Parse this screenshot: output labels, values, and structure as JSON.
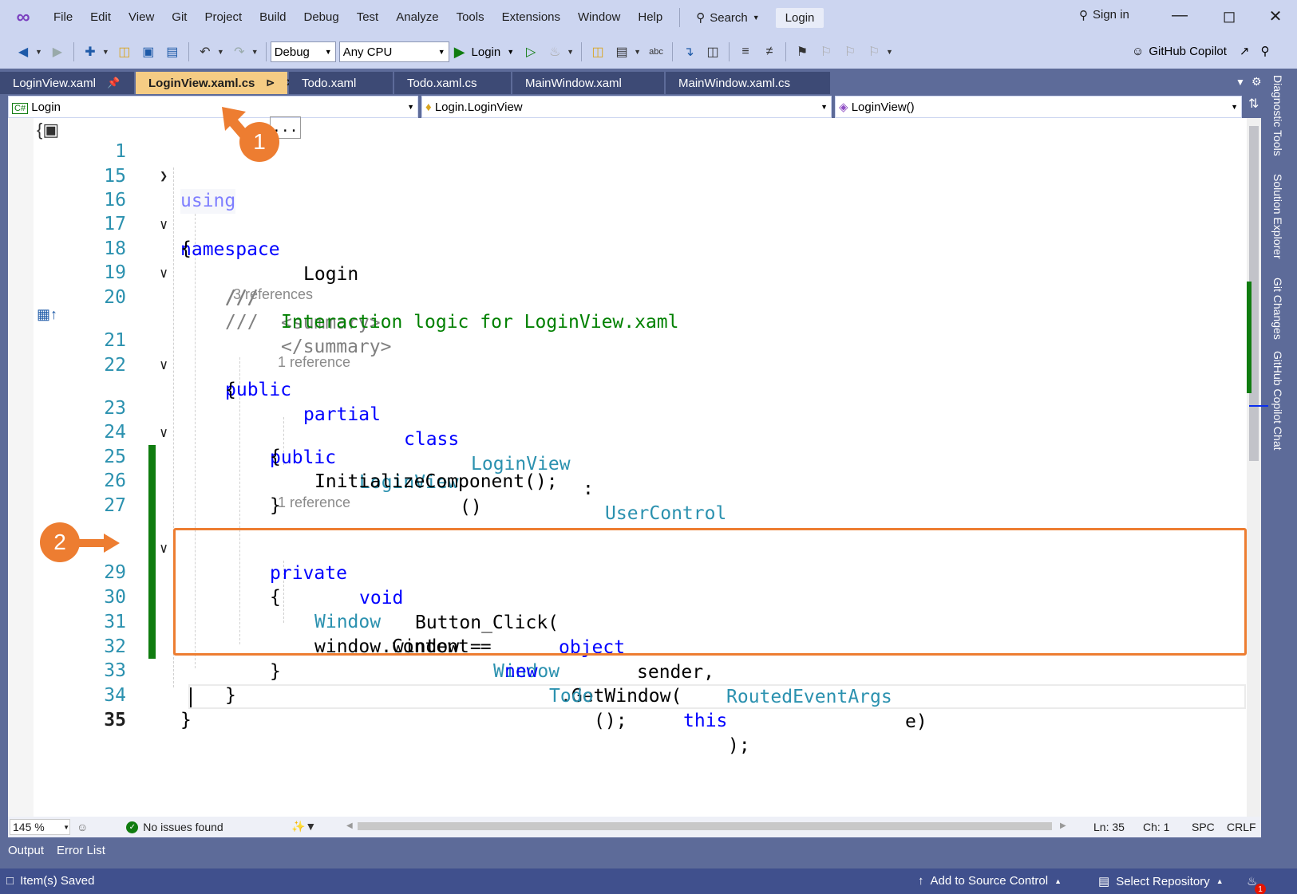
{
  "menu": {
    "items": [
      "File",
      "Edit",
      "View",
      "Git",
      "Project",
      "Build",
      "Debug",
      "Test",
      "Analyze",
      "Tools",
      "Extensions",
      "Window",
      "Help"
    ],
    "search_label": "Search",
    "solution_name": "Login",
    "sign_in": "Sign in"
  },
  "toolbar": {
    "configuration": "Debug",
    "platform": "Any CPU",
    "run_target": "Login",
    "copilot_label": "GitHub Copilot"
  },
  "tabs": [
    {
      "label": "LoginView.xaml"
    },
    {
      "label": "LoginView.xaml.cs"
    },
    {
      "label": "Todo.xaml"
    },
    {
      "label": "Todo.xaml.cs"
    },
    {
      "label": "MainWindow.xaml"
    },
    {
      "label": "MainWindow.xaml.cs"
    }
  ],
  "navbar": {
    "project": "Login",
    "type": "Login.LoginView",
    "member": "LoginView()"
  },
  "code": {
    "line_numbers": [
      "1",
      "15",
      "16",
      "17",
      "18",
      "19",
      "20",
      "21",
      "22",
      "23",
      "24",
      "25",
      "26",
      "27",
      "29",
      "30",
      "31",
      "32",
      "33",
      "34",
      "35"
    ],
    "l1_using": "using",
    "l1_collapsed": "...",
    "l16_kw": "namespace",
    "l16_name": "Login",
    "brace_open": "{",
    "brace_close": "}",
    "l18_prefix": "/// ",
    "l18_tag": "<summary>",
    "l19_prefix": "/// ",
    "l19_text": "Interaction logic for LoginView.xaml",
    "l20_prefix": "/// ",
    "l20_tag": "</summary>",
    "lens_class": "3 references",
    "l21_kw1": "public",
    "l21_kw2": "partial",
    "l21_kw3": "class",
    "l21_type": "LoginView",
    "l21_colon": ":",
    "l21_base": "UserControl",
    "lens_ctor": "1 reference",
    "l23_kw": "public",
    "l23_type": "LoginView",
    "l23_rest": "()",
    "l25_text": "InitializeComponent();",
    "lens_method": "1 reference",
    "l28_kw1": "private",
    "l28_kw2": "void",
    "l28_name": "Button_Click(",
    "l28_kw3": "object",
    "l28_p1": "sender,",
    "l28_type": "RoutedEventArgs",
    "l28_p2": "e)",
    "l30_type1": "Window",
    "l30_mid": "window =",
    "l30_type2": "Window",
    "l30_call": ".GetWindow(",
    "l30_kw": "this",
    "l30_end": ");",
    "l31_start": "window.Content =",
    "l31_kw": "new",
    "l31_type": "Todo",
    "l31_end": "();"
  },
  "callouts": {
    "one": "1",
    "two": "2"
  },
  "editor_status": {
    "zoom": "145 %",
    "issues": "No issues found",
    "line": "Ln: 35",
    "col": "Ch: 1",
    "whitespace": "SPC",
    "line_ending": "CRLF"
  },
  "dock_tabs": [
    "Diagnostic Tools",
    "Solution Explorer",
    "Git Changes",
    "GitHub Copilot Chat"
  ],
  "tool_tabs": [
    "Output",
    "Error List"
  ],
  "statusbar": {
    "message": "Item(s) Saved",
    "source_control": "Add to Source Control",
    "repository": "Select Repository",
    "notification_count": "1"
  },
  "colors": {
    "accent_orange": "#ed7d31",
    "active_tab": "#f5cc84",
    "keyword": "#0000ff",
    "type": "#2b91af",
    "comment": "#008000",
    "change_bar": "#107c10"
  }
}
